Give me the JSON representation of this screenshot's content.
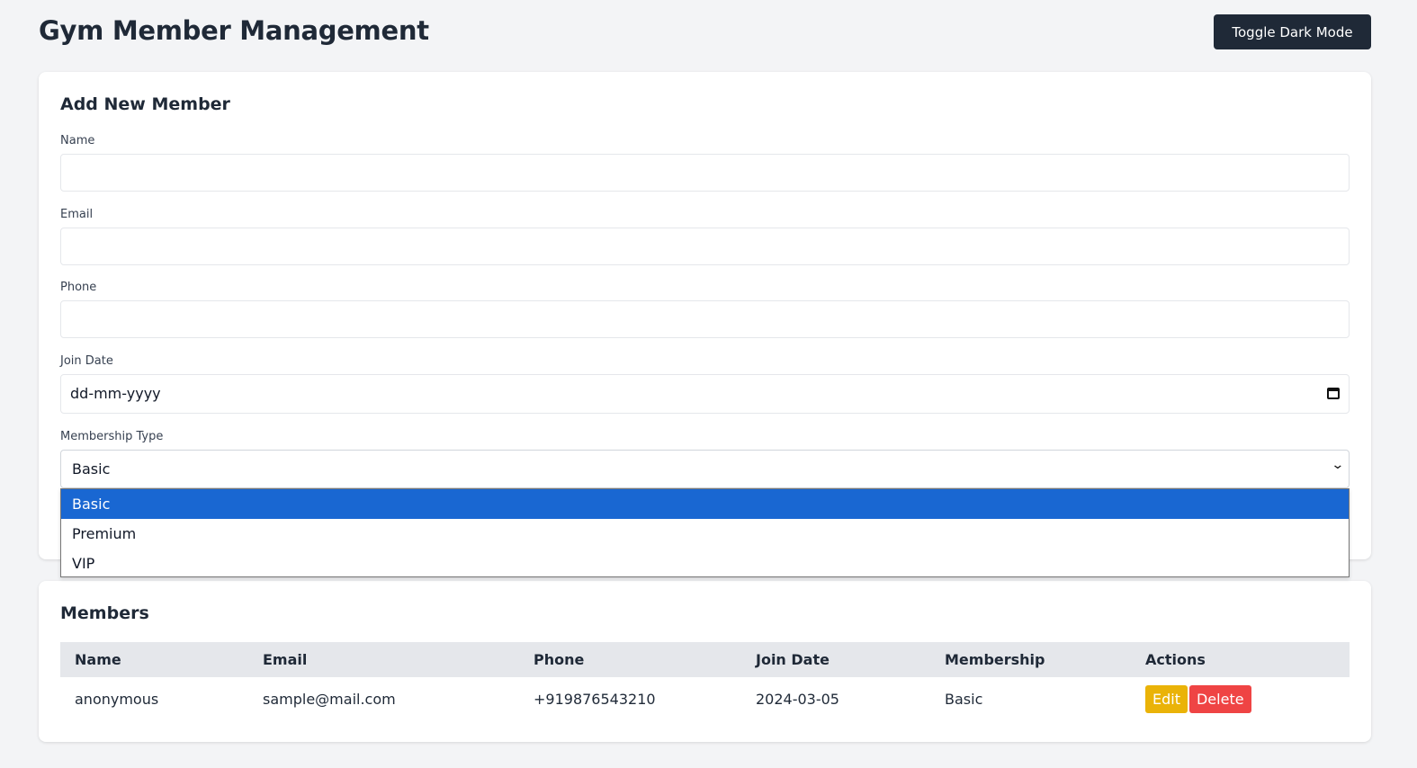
{
  "header": {
    "title": "Gym Member Management",
    "toggle_label": "Toggle Dark Mode"
  },
  "form": {
    "title": "Add New Member",
    "fields": {
      "name": {
        "label": "Name",
        "value": ""
      },
      "email": {
        "label": "Email",
        "value": ""
      },
      "phone": {
        "label": "Phone",
        "value": ""
      },
      "join_date": {
        "label": "Join Date",
        "value": "dd-mm-yyyy"
      },
      "membership": {
        "label": "Membership Type",
        "value": "Basic",
        "options": [
          "Basic",
          "Premium",
          "VIP"
        ],
        "highlighted": "Basic"
      }
    }
  },
  "members": {
    "title": "Members",
    "columns": [
      "Name",
      "Email",
      "Phone",
      "Join Date",
      "Membership",
      "Actions"
    ],
    "rows": [
      {
        "name": "anonymous",
        "email": "sample@mail.com",
        "phone": "+919876543210",
        "join_date": "2024-03-05",
        "membership": "Basic",
        "edit_label": "Edit",
        "delete_label": "Delete"
      }
    ]
  },
  "colors": {
    "primary_dark": "#1f2937",
    "highlight": "#1967d2",
    "edit": "#eab308",
    "delete": "#ef4444"
  }
}
